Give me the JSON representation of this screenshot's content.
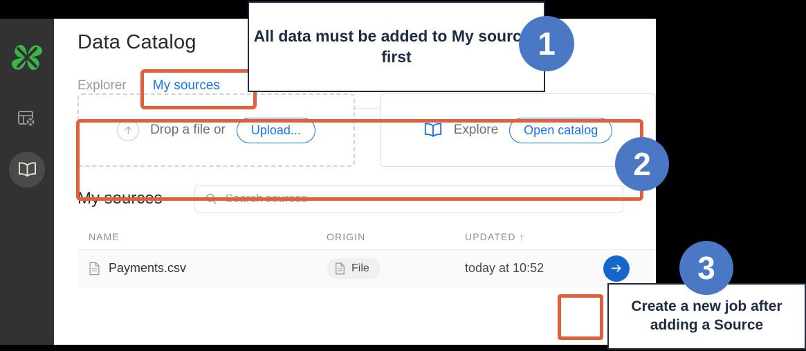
{
  "app": {
    "title": "Data Catalog"
  },
  "sidebar": {
    "logo_name": "clover-logo",
    "items": [
      {
        "icon": "table-clover-icon",
        "label": ""
      },
      {
        "icon": "open-book-icon",
        "label": ""
      }
    ]
  },
  "tabs": [
    {
      "label": "Explorer",
      "active": false
    },
    {
      "label": "My sources",
      "active": true
    }
  ],
  "cards": {
    "drop": {
      "icon": "upload-arrow-icon",
      "label": "Drop a file or",
      "button": "Upload..."
    },
    "explore": {
      "icon": "open-book-icon",
      "label": "Explore",
      "button": "Open catalog"
    }
  },
  "sources": {
    "heading": "My sources",
    "search_placeholder": "Search sources",
    "search_value": "",
    "search_icon": "search-icon",
    "columns": [
      "NAME",
      "ORIGIN",
      "UPDATED ↑"
    ],
    "rows": [
      {
        "name": "Payments.csv",
        "name_icon": "file-document-icon",
        "origin": "File",
        "origin_icon": "file-document-icon",
        "updated": "today at 10:52",
        "action_icon": "arrow-right-icon"
      }
    ]
  },
  "callouts": [
    {
      "number": "1",
      "text": "All data must be added to My sources first"
    },
    {
      "number": "2",
      "text": ""
    },
    {
      "number": "3",
      "text": "Create a new job after adding a Source"
    }
  ],
  "colors": {
    "accent_blue": "#1a73e8",
    "highlight_orange": "#e0603c",
    "badge_blue": "#4a78c4",
    "logo_green": "#3cb44a",
    "sidebar_dark": "#323232"
  }
}
